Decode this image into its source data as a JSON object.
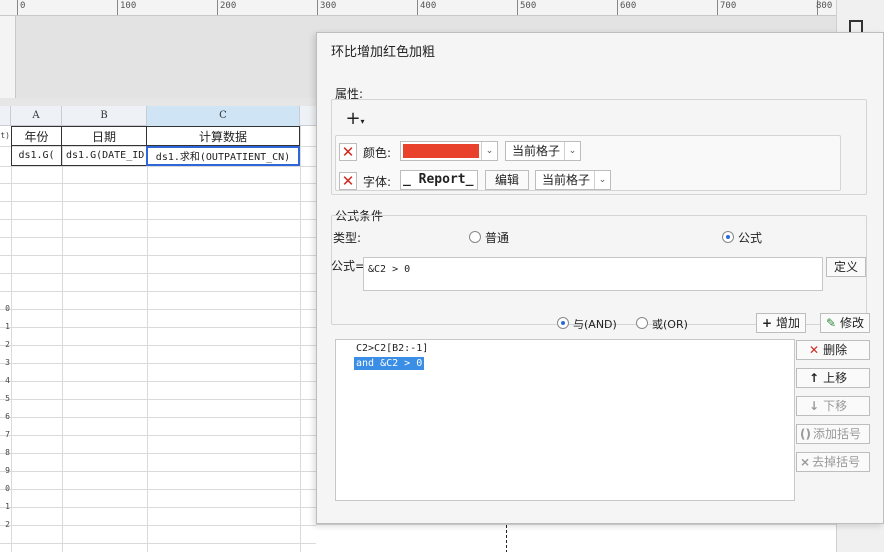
{
  "ruler": {
    "ticks": [
      "0",
      "100",
      "200",
      "300",
      "400",
      "500",
      "600",
      "700",
      "800"
    ]
  },
  "spreadsheet": {
    "columns": [
      "A",
      "B",
      "C"
    ],
    "header_row": [
      "年份",
      "日期",
      "计算数据"
    ],
    "data_row": [
      "ds1.G(",
      "ds1.G(DATE_ID",
      "ds1.求和(OUTPATIENT_CN)"
    ],
    "row_numbers": [
      "",
      "t)",
      "",
      "",
      "",
      "",
      "",
      "",
      "0",
      "1",
      "2",
      "3",
      "4",
      "5",
      "6",
      "7",
      "8",
      "9",
      "0",
      "1",
      "2"
    ]
  },
  "dialog": {
    "title": "环比增加红色加粗",
    "attributes": {
      "label": "属性:",
      "add_label": "+",
      "color_label": "颜色:",
      "color_value": "#e8412c",
      "color_scope": "当前格子",
      "font_label": "字体:",
      "font_preview": "_ Report_",
      "edit_label": "编辑",
      "font_scope": "当前格子"
    },
    "condition": {
      "label": "公式条件",
      "type_label": "类型:",
      "type_normal": "普通",
      "type_formula": "公式",
      "formula_label": "公式=",
      "formula_value": "&C2 > 0",
      "define_label": "定义",
      "and_label": "与(AND)",
      "or_label": "或(OR)",
      "add_label": "增加",
      "modify_label": "修改",
      "items": [
        "C2>C2[B2:-1]",
        "and &C2 > 0"
      ],
      "delete_label": "删除",
      "move_up_label": "上移",
      "move_down_label": "下移",
      "add_bracket_label": "添加括号",
      "remove_bracket_label": "去掉括号"
    }
  },
  "colors": {
    "accent": "#2f66d8",
    "danger": "#d2281e",
    "selection": "#3a8ee6"
  }
}
